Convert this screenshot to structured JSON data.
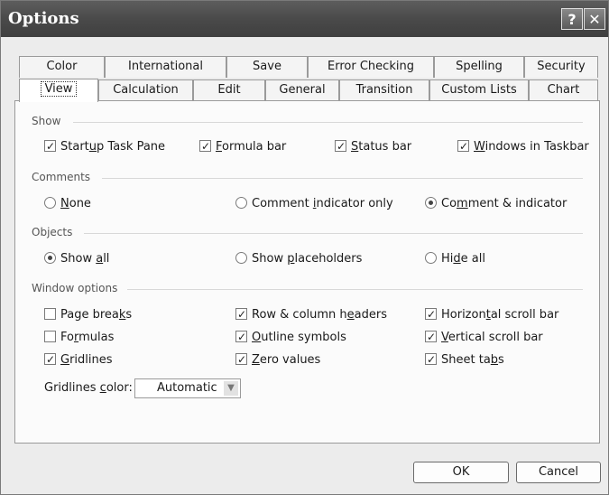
{
  "window": {
    "title": "Options"
  },
  "titlebar_buttons": {
    "help": "?",
    "close": "✕"
  },
  "tabs_back": [
    "Color",
    "International",
    "Save",
    "Error Checking",
    "Spelling",
    "Security"
  ],
  "tabs_front": [
    "View",
    "Calculation",
    "Edit",
    "General",
    "Transition",
    "Custom Lists",
    "Chart"
  ],
  "active_tab": "View",
  "show": {
    "label": "Show",
    "startup_task_pane": {
      "pre": "Start",
      "u": "u",
      "post": "p Task Pane",
      "checked": true
    },
    "formula_bar": {
      "pre": "",
      "u": "F",
      "post": "ormula bar",
      "checked": true
    },
    "status_bar": {
      "pre": "",
      "u": "S",
      "post": "tatus bar",
      "checked": true
    },
    "windows_in_taskbar": {
      "pre": "",
      "u": "W",
      "post": "indows in Taskbar",
      "checked": true
    }
  },
  "comments": {
    "label": "Comments",
    "none": {
      "pre": "",
      "u": "N",
      "post": "one",
      "selected": false
    },
    "indicator_only": {
      "pre": "Comment ",
      "u": "i",
      "post": "ndicator only",
      "selected": false
    },
    "comment_and_indicator": {
      "pre": "Co",
      "u": "m",
      "post": "ment & indicator",
      "selected": true
    }
  },
  "objects": {
    "label": "Objects",
    "show_all": {
      "pre": "Show ",
      "u": "a",
      "post": "ll",
      "selected": true
    },
    "show_placeholders": {
      "pre": "Show ",
      "u": "p",
      "post": "laceholders",
      "selected": false
    },
    "hide_all": {
      "pre": "Hi",
      "u": "d",
      "post": "e all",
      "selected": false
    }
  },
  "window_options": {
    "label": "Window options",
    "page_breaks": {
      "pre": "Page brea",
      "u": "k",
      "post": "s",
      "checked": false
    },
    "formulas": {
      "pre": "Fo",
      "u": "r",
      "post": "mulas",
      "checked": false
    },
    "gridlines": {
      "pre": "",
      "u": "G",
      "post": "ridlines",
      "checked": true
    },
    "row_col_headers": {
      "pre": "Row & column h",
      "u": "e",
      "post": "aders",
      "checked": true
    },
    "outline_symbols": {
      "pre": "",
      "u": "O",
      "post": "utline symbols",
      "checked": true
    },
    "zero_values": {
      "pre": "",
      "u": "Z",
      "post": "ero values",
      "checked": true
    },
    "horizontal_scroll": {
      "pre": "Horizon",
      "u": "t",
      "post": "al scroll bar",
      "checked": true
    },
    "vertical_scroll": {
      "pre": "",
      "u": "V",
      "post": "ertical scroll bar",
      "checked": true
    },
    "sheet_tabs": {
      "pre": "Sheet ta",
      "u": "b",
      "post": "s",
      "checked": true
    },
    "gridlines_color": {
      "pre": "Gridlines ",
      "u": "c",
      "post": "olor:",
      "value": "Automatic"
    }
  },
  "buttons": {
    "ok": "OK",
    "cancel": "Cancel"
  }
}
